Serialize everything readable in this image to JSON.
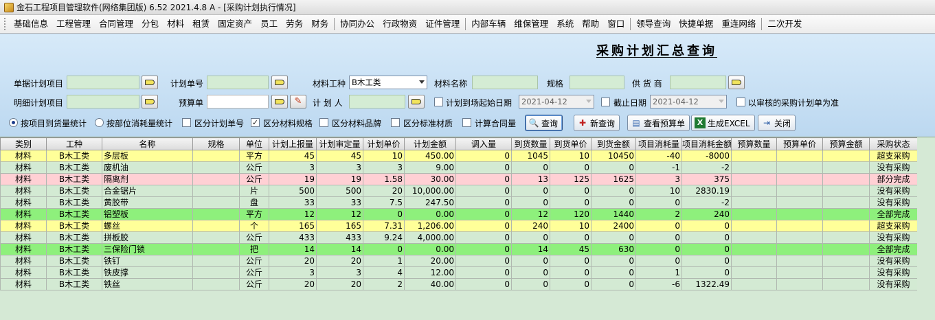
{
  "window": {
    "title": "金石工程项目管理软件(网络集团版) 6.52  2021.4.8 A - [采购计划执行情况]"
  },
  "menu": [
    "基础信息",
    "工程管理",
    "合同管理",
    "分包",
    "材料",
    "租赁",
    "固定资产",
    "员工",
    "劳务",
    "财务",
    "|",
    "协同办公",
    "行政物资",
    "证件管理",
    "|",
    "内部车辆",
    "维保管理",
    "系统",
    "帮助",
    "窗口",
    "|",
    "领导查询",
    "快捷单据",
    "重连网络",
    "|",
    "二次开发"
  ],
  "page_title": "采购计划汇总查询",
  "filters": {
    "doc_project_label": "单据计划项目",
    "plan_no_label": "计划单号",
    "material_type_label": "材料工种",
    "material_type_value": "B木工类",
    "material_name_label": "材料名称",
    "spec_label": "规格",
    "supplier_label": "供 货 商",
    "detail_project_label": "明细计划项目",
    "budget_label": "预算单",
    "planner_label": "计 划 人",
    "arrival_start_label": "计划到场起始日期",
    "arrival_start_value": "2021-04-12",
    "end_date_label": "截止日期",
    "end_date_value": "2021-04-12",
    "audited_only_label": "以审核的采购计划单为准"
  },
  "options": {
    "radio_project": "按项目到货量统计",
    "radio_part": "按部位消耗量统计",
    "chk_plan_no": "区分计划单号",
    "chk_spec": "区分材料规格",
    "chk_brand": "区分材料品牌",
    "chk_standard": "区分标准材质",
    "chk_contract": "计算合同量"
  },
  "buttons": {
    "query": "查询",
    "new_query": "新查询",
    "view_budget": "查看预算单",
    "excel": "生成EXCEL",
    "close": "关闭"
  },
  "table": {
    "columns": [
      "类别",
      "工种",
      "名称",
      "规格",
      "单位",
      "计划上报量",
      "计划审定量",
      "计划单价",
      "计划金额",
      "调入量",
      "到货数量",
      "到货单价",
      "到货金额",
      "项目消耗量",
      "项目消耗金额",
      "预算数量",
      "预算单价",
      "预算金额",
      "采购状态"
    ],
    "rows": [
      {
        "row_color": "yellow",
        "cells": [
          "材料",
          "B木工类",
          "多层板",
          "",
          "平方",
          "45",
          "45",
          "10",
          "450.00",
          "0",
          "1045",
          "10",
          "10450",
          "-40",
          "-8000",
          "",
          "",
          "",
          "超支采购"
        ]
      },
      {
        "row_color": "normal",
        "cells": [
          "材料",
          "B木工类",
          "废机油",
          "",
          "公斤",
          "3",
          "3",
          "3",
          "9.00",
          "0",
          "0",
          "0",
          "0",
          "-1",
          "-2",
          "",
          "",
          "",
          "没有采购"
        ]
      },
      {
        "row_color": "pink",
        "cells": [
          "材料",
          "B木工类",
          "隔离剂",
          "",
          "公斤",
          "19",
          "19",
          "1.58",
          "30.00",
          "0",
          "13",
          "125",
          "1625",
          "3",
          "375",
          "",
          "",
          "",
          "部分完成"
        ]
      },
      {
        "row_color": "normal",
        "cells": [
          "材料",
          "B木工类",
          "合金锯片",
          "",
          "片",
          "500",
          "500",
          "20",
          "10,000.00",
          "0",
          "0",
          "0",
          "0",
          "10",
          "2830.19",
          "",
          "",
          "",
          "没有采购"
        ]
      },
      {
        "row_color": "normal",
        "cells": [
          "材料",
          "B木工类",
          "黄胶带",
          "",
          "盘",
          "33",
          "33",
          "7.5",
          "247.50",
          "0",
          "0",
          "0",
          "0",
          "0",
          "-2",
          "",
          "",
          "",
          "没有采购"
        ]
      },
      {
        "row_color": "green",
        "cells": [
          "材料",
          "B木工类",
          "铝塑板",
          "",
          "平方",
          "12",
          "12",
          "0",
          "0.00",
          "0",
          "12",
          "120",
          "1440",
          "2",
          "240",
          "",
          "",
          "",
          "全部完成"
        ]
      },
      {
        "row_color": "yellow",
        "cells": [
          "材料",
          "B木工类",
          "螺丝",
          "",
          "个",
          "165",
          "165",
          "7.31",
          "1,206.00",
          "0",
          "240",
          "10",
          "2400",
          "0",
          "0",
          "",
          "",
          "",
          "超支采购"
        ]
      },
      {
        "row_color": "normal",
        "cells": [
          "材料",
          "B木工类",
          "拼板胶",
          "",
          "公斤",
          "433",
          "433",
          "9.24",
          "4,000.00",
          "0",
          "0",
          "0",
          "0",
          "0",
          "0",
          "",
          "",
          "",
          "没有采购"
        ]
      },
      {
        "row_color": "green",
        "cells": [
          "材料",
          "B木工类",
          "三保险门锁",
          "",
          "把",
          "14",
          "14",
          "0",
          "0.00",
          "0",
          "14",
          "45",
          "630",
          "0",
          "0",
          "",
          "",
          "",
          "全部完成"
        ]
      },
      {
        "row_color": "normal",
        "cells": [
          "材料",
          "B木工类",
          "铁钉",
          "",
          "公斤",
          "20",
          "20",
          "1",
          "20.00",
          "0",
          "0",
          "0",
          "0",
          "0",
          "0",
          "",
          "",
          "",
          "没有采购"
        ]
      },
      {
        "row_color": "normal",
        "cells": [
          "材料",
          "B木工类",
          "铁皮撑",
          "",
          "公斤",
          "3",
          "3",
          "4",
          "12.00",
          "0",
          "0",
          "0",
          "0",
          "1",
          "0",
          "",
          "",
          "",
          "没有采购"
        ]
      },
      {
        "row_color": "normal",
        "cells": [
          "材料",
          "B木工类",
          "铁丝",
          "",
          "公斤",
          "20",
          "20",
          "2",
          "40.00",
          "0",
          "0",
          "0",
          "0",
          "-6",
          "1322.49",
          "",
          "",
          "",
          "没有采购"
        ]
      }
    ]
  }
}
